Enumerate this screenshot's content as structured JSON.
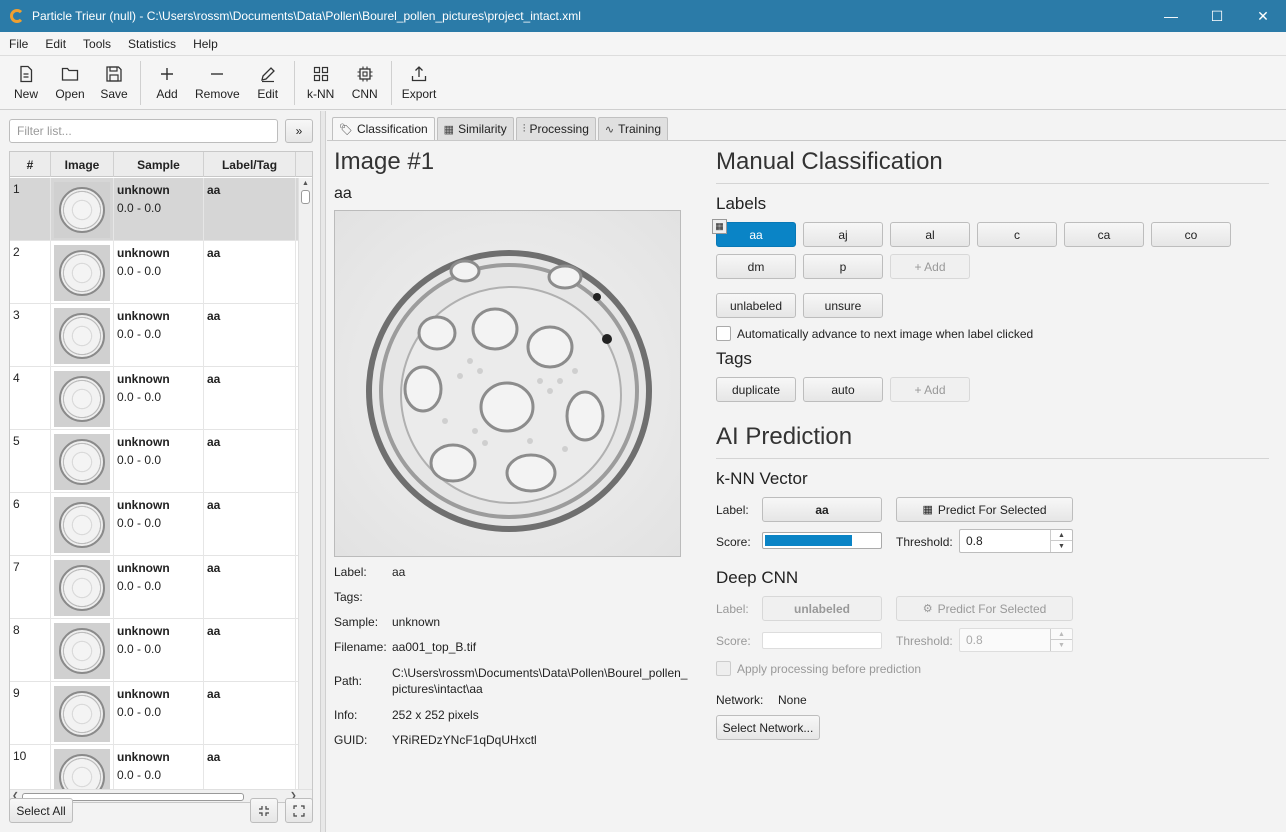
{
  "window": {
    "title": "Particle Trieur (null)  -  C:\\Users\\rossm\\Documents\\Data\\Pollen\\Bourel_pollen_pictures\\project_intact.xml",
    "minimize": "—",
    "maximize": "☐",
    "close": "✕"
  },
  "menu": [
    "File",
    "Edit",
    "Tools",
    "Statistics",
    "Help"
  ],
  "toolbar": {
    "new": "New",
    "open": "Open",
    "save": "Save",
    "add": "Add",
    "remove": "Remove",
    "edit": "Edit",
    "knn": "k-NN",
    "cnn": "CNN",
    "export": "Export"
  },
  "left": {
    "filter_placeholder": "Filter list...",
    "expand_icon": "»",
    "columns": [
      "#",
      "Image",
      "Sample",
      "Label/Tag"
    ],
    "rows": [
      {
        "num": "1",
        "sample": "unknown",
        "range": "0.0 - 0.0",
        "label": "aa"
      },
      {
        "num": "2",
        "sample": "unknown",
        "range": "0.0 - 0.0",
        "label": "aa"
      },
      {
        "num": "3",
        "sample": "unknown",
        "range": "0.0 - 0.0",
        "label": "aa"
      },
      {
        "num": "4",
        "sample": "unknown",
        "range": "0.0 - 0.0",
        "label": "aa"
      },
      {
        "num": "5",
        "sample": "unknown",
        "range": "0.0 - 0.0",
        "label": "aa"
      },
      {
        "num": "6",
        "sample": "unknown",
        "range": "0.0 - 0.0",
        "label": "aa"
      },
      {
        "num": "7",
        "sample": "unknown",
        "range": "0.0 - 0.0",
        "label": "aa"
      },
      {
        "num": "8",
        "sample": "unknown",
        "range": "0.0 - 0.0",
        "label": "aa"
      },
      {
        "num": "9",
        "sample": "unknown",
        "range": "0.0 - 0.0",
        "label": "aa"
      },
      {
        "num": "10",
        "sample": "unknown",
        "range": "0.0 - 0.0",
        "label": "aa"
      }
    ],
    "select_all": "Select All"
  },
  "tabs": {
    "classification": "Classification",
    "similarity": "Similarity",
    "processing": "Processing",
    "training": "Training"
  },
  "image": {
    "title": "Image #1",
    "label_value": "aa",
    "details": {
      "label_key": "Label:",
      "label_val": "aa",
      "tags_key": "Tags:",
      "tags_val": "",
      "sample_key": "Sample:",
      "sample_val": "unknown",
      "filename_key": "Filename:",
      "filename_val": "aa001_top_B.tif",
      "path_key": "Path:",
      "path_val": "C:\\Users\\rossm\\Documents\\Data\\Pollen\\Bourel_pollen_pictures\\intact\\aa",
      "info_key": "Info:",
      "info_val": "252 x 252 pixels",
      "guid_key": "GUID:",
      "guid_val": "YRiREDzYNcF1qDqUHxctl"
    }
  },
  "manual": {
    "heading": "Manual Classification",
    "labels_heading": "Labels",
    "labels": [
      "aa",
      "aj",
      "al",
      "c",
      "ca",
      "co",
      "dm",
      "p"
    ],
    "add": "+ Add",
    "unlabeled": "unlabeled",
    "unsure": "unsure",
    "auto_advance": "Automatically advance to next image when label clicked",
    "tags_heading": "Tags",
    "tags": [
      "duplicate",
      "auto"
    ],
    "tags_add": "+ Add"
  },
  "ai": {
    "heading": "AI Prediction",
    "knn": {
      "heading": "k-NN Vector",
      "label_key": "Label:",
      "label_val": "aa",
      "predict": "Predict For Selected",
      "score_key": "Score:",
      "score_fraction": 0.75,
      "threshold_key": "Threshold:",
      "threshold_val": "0.8"
    },
    "cnn": {
      "heading": "Deep CNN",
      "label_key": "Label:",
      "label_val": "unlabeled",
      "predict": "Predict For Selected",
      "score_key": "Score:",
      "threshold_key": "Threshold:",
      "threshold_val": "0.8",
      "apply_processing": "Apply processing before prediction"
    },
    "network_key": "Network:",
    "network_val": "None",
    "select_network": "Select Network..."
  },
  "colors": {
    "titlebar": "#2b7ba8",
    "accent": "#0a84c6"
  }
}
